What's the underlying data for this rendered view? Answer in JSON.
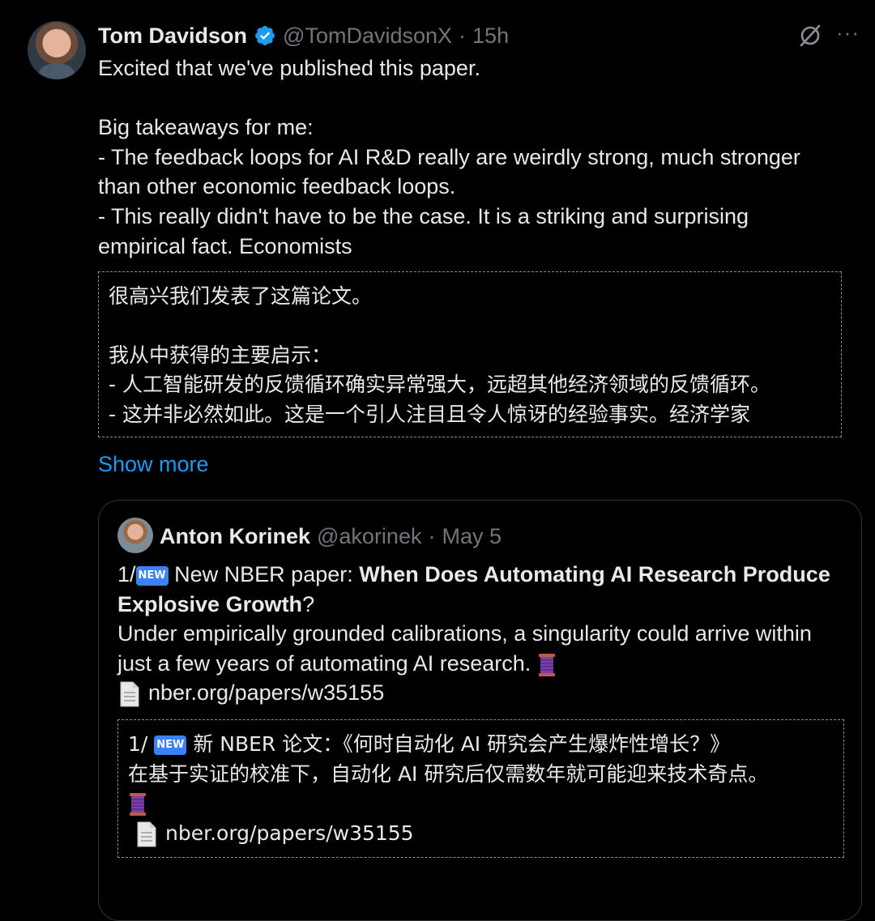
{
  "tweet": {
    "author_name": "Tom Davidson",
    "author_handle": "@TomDavidsonX",
    "separator": "·",
    "time": "15h",
    "body": "Excited that we've published this paper.\n\nBig takeaways for me:\n- The feedback loops for AI R&D really are weirdly strong, much stronger\nthan other economic feedback loops.\n- This really didn't have to be the case. It is a striking and surprising\nempirical fact. Economists",
    "translation": "很高兴我们发表了这篇论文。\n\n我从中获得的主要启示：\n- 人工智能研发的反馈循环确实异常强大，远超其他经济领域的反馈循环。\n- 这并非必然如此。这是一个引人注目且令人惊讶的经验事实。经济学家",
    "show_more": "Show more",
    "more_dots": "···"
  },
  "quote": {
    "author_name": "Anton Korinek",
    "author_handle": "@akorinek",
    "separator": "·",
    "date": "May 5",
    "line1_prefix": "1/",
    "new_badge": "NEW",
    "line1_text": " New NBER paper: ",
    "paper_title": "When Does Automating AI Research Produce Explosive Growth",
    "title_end": "?",
    "line2": "Under empirically grounded calibrations, a singularity could arrive within just a few years of automating AI research.",
    "link": "nber.org/papers/w35155",
    "trans_line1_prefix": "1/ ",
    "trans_line1": " 新 NBER 论文：《何时自动化 AI 研究会产生爆炸性增长？》",
    "trans_line2": "在基于实证的校准下，自动化 AI 研究后仅需数年就可能迎来技术奇点。",
    "trans_link": "nber.org/papers/w35155"
  },
  "colors": {
    "background": "#000000",
    "text": "#e7e9ea",
    "secondary": "#71767b",
    "link": "#1d9bf0",
    "verified": "#1d9bf0"
  }
}
